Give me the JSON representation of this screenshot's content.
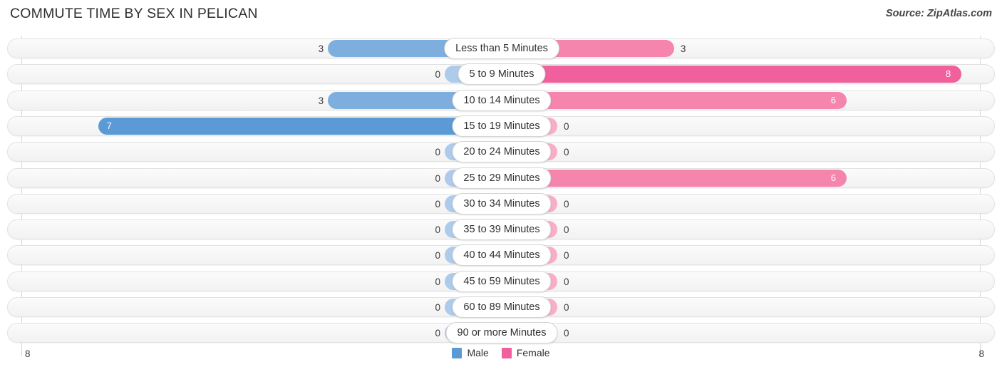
{
  "header": {
    "title": "COMMUTE TIME BY SEX IN PELICAN",
    "source": "Source: ZipAtlas.com"
  },
  "legend": {
    "male_label": "Male",
    "female_label": "Female",
    "male_color": "#5B9BD5",
    "female_color": "#F0609C"
  },
  "axis": {
    "left_max_label": "8",
    "right_max_label": "8",
    "max_value": 8
  },
  "chart_data": {
    "type": "bar",
    "orientation": "horizontal",
    "style": "diverging-bidirectional",
    "title": "COMMUTE TIME BY SEX IN PELICAN",
    "subtitle": "Source: ZipAtlas.com",
    "xlabel": "",
    "ylabel": "",
    "xlim": [
      8,
      8
    ],
    "grid": true,
    "legend_position": "bottom-center",
    "categories": [
      "Less than 5 Minutes",
      "5 to 9 Minutes",
      "10 to 14 Minutes",
      "15 to 19 Minutes",
      "20 to 24 Minutes",
      "25 to 29 Minutes",
      "30 to 34 Minutes",
      "35 to 39 Minutes",
      "40 to 44 Minutes",
      "45 to 59 Minutes",
      "60 to 89 Minutes",
      "90 or more Minutes"
    ],
    "series": [
      {
        "name": "Male",
        "color": "#5B9BD5",
        "values": [
          3,
          0,
          3,
          7,
          0,
          0,
          0,
          0,
          0,
          0,
          0,
          0
        ]
      },
      {
        "name": "Female",
        "color": "#F0609C",
        "values": [
          3,
          8,
          6,
          0,
          0,
          6,
          0,
          0,
          0,
          0,
          0,
          0
        ]
      }
    ]
  },
  "rows": [
    {
      "label": "Less than 5 Minutes",
      "male": "3",
      "female": "3",
      "male_value": 3,
      "female_value": 3,
      "male_inside": false,
      "female_inside": false
    },
    {
      "label": "5 to 9 Minutes",
      "male": "0",
      "female": "8",
      "male_value": 0,
      "female_value": 8,
      "male_inside": false,
      "female_inside": true
    },
    {
      "label": "10 to 14 Minutes",
      "male": "3",
      "female": "6",
      "male_value": 3,
      "female_value": 6,
      "male_inside": false,
      "female_inside": true
    },
    {
      "label": "15 to 19 Minutes",
      "male": "7",
      "female": "0",
      "male_value": 7,
      "female_value": 0,
      "male_inside": true,
      "female_inside": false
    },
    {
      "label": "20 to 24 Minutes",
      "male": "0",
      "female": "0",
      "male_value": 0,
      "female_value": 0,
      "male_inside": false,
      "female_inside": false
    },
    {
      "label": "25 to 29 Minutes",
      "male": "0",
      "female": "6",
      "male_value": 0,
      "female_value": 6,
      "male_inside": false,
      "female_inside": true
    },
    {
      "label": "30 to 34 Minutes",
      "male": "0",
      "female": "0",
      "male_value": 0,
      "female_value": 0,
      "male_inside": false,
      "female_inside": false
    },
    {
      "label": "35 to 39 Minutes",
      "male": "0",
      "female": "0",
      "male_value": 0,
      "female_value": 0,
      "male_inside": false,
      "female_inside": false
    },
    {
      "label": "40 to 44 Minutes",
      "male": "0",
      "female": "0",
      "male_value": 0,
      "female_value": 0,
      "male_inside": false,
      "female_inside": false
    },
    {
      "label": "45 to 59 Minutes",
      "male": "0",
      "female": "0",
      "male_value": 0,
      "female_value": 0,
      "male_inside": false,
      "female_inside": false
    },
    {
      "label": "60 to 89 Minutes",
      "male": "0",
      "female": "0",
      "male_value": 0,
      "female_value": 0,
      "male_inside": false,
      "female_inside": false
    },
    {
      "label": "90 or more Minutes",
      "male": "0",
      "female": "0",
      "male_value": 0,
      "female_value": 0,
      "male_inside": false,
      "female_inside": false
    }
  ]
}
